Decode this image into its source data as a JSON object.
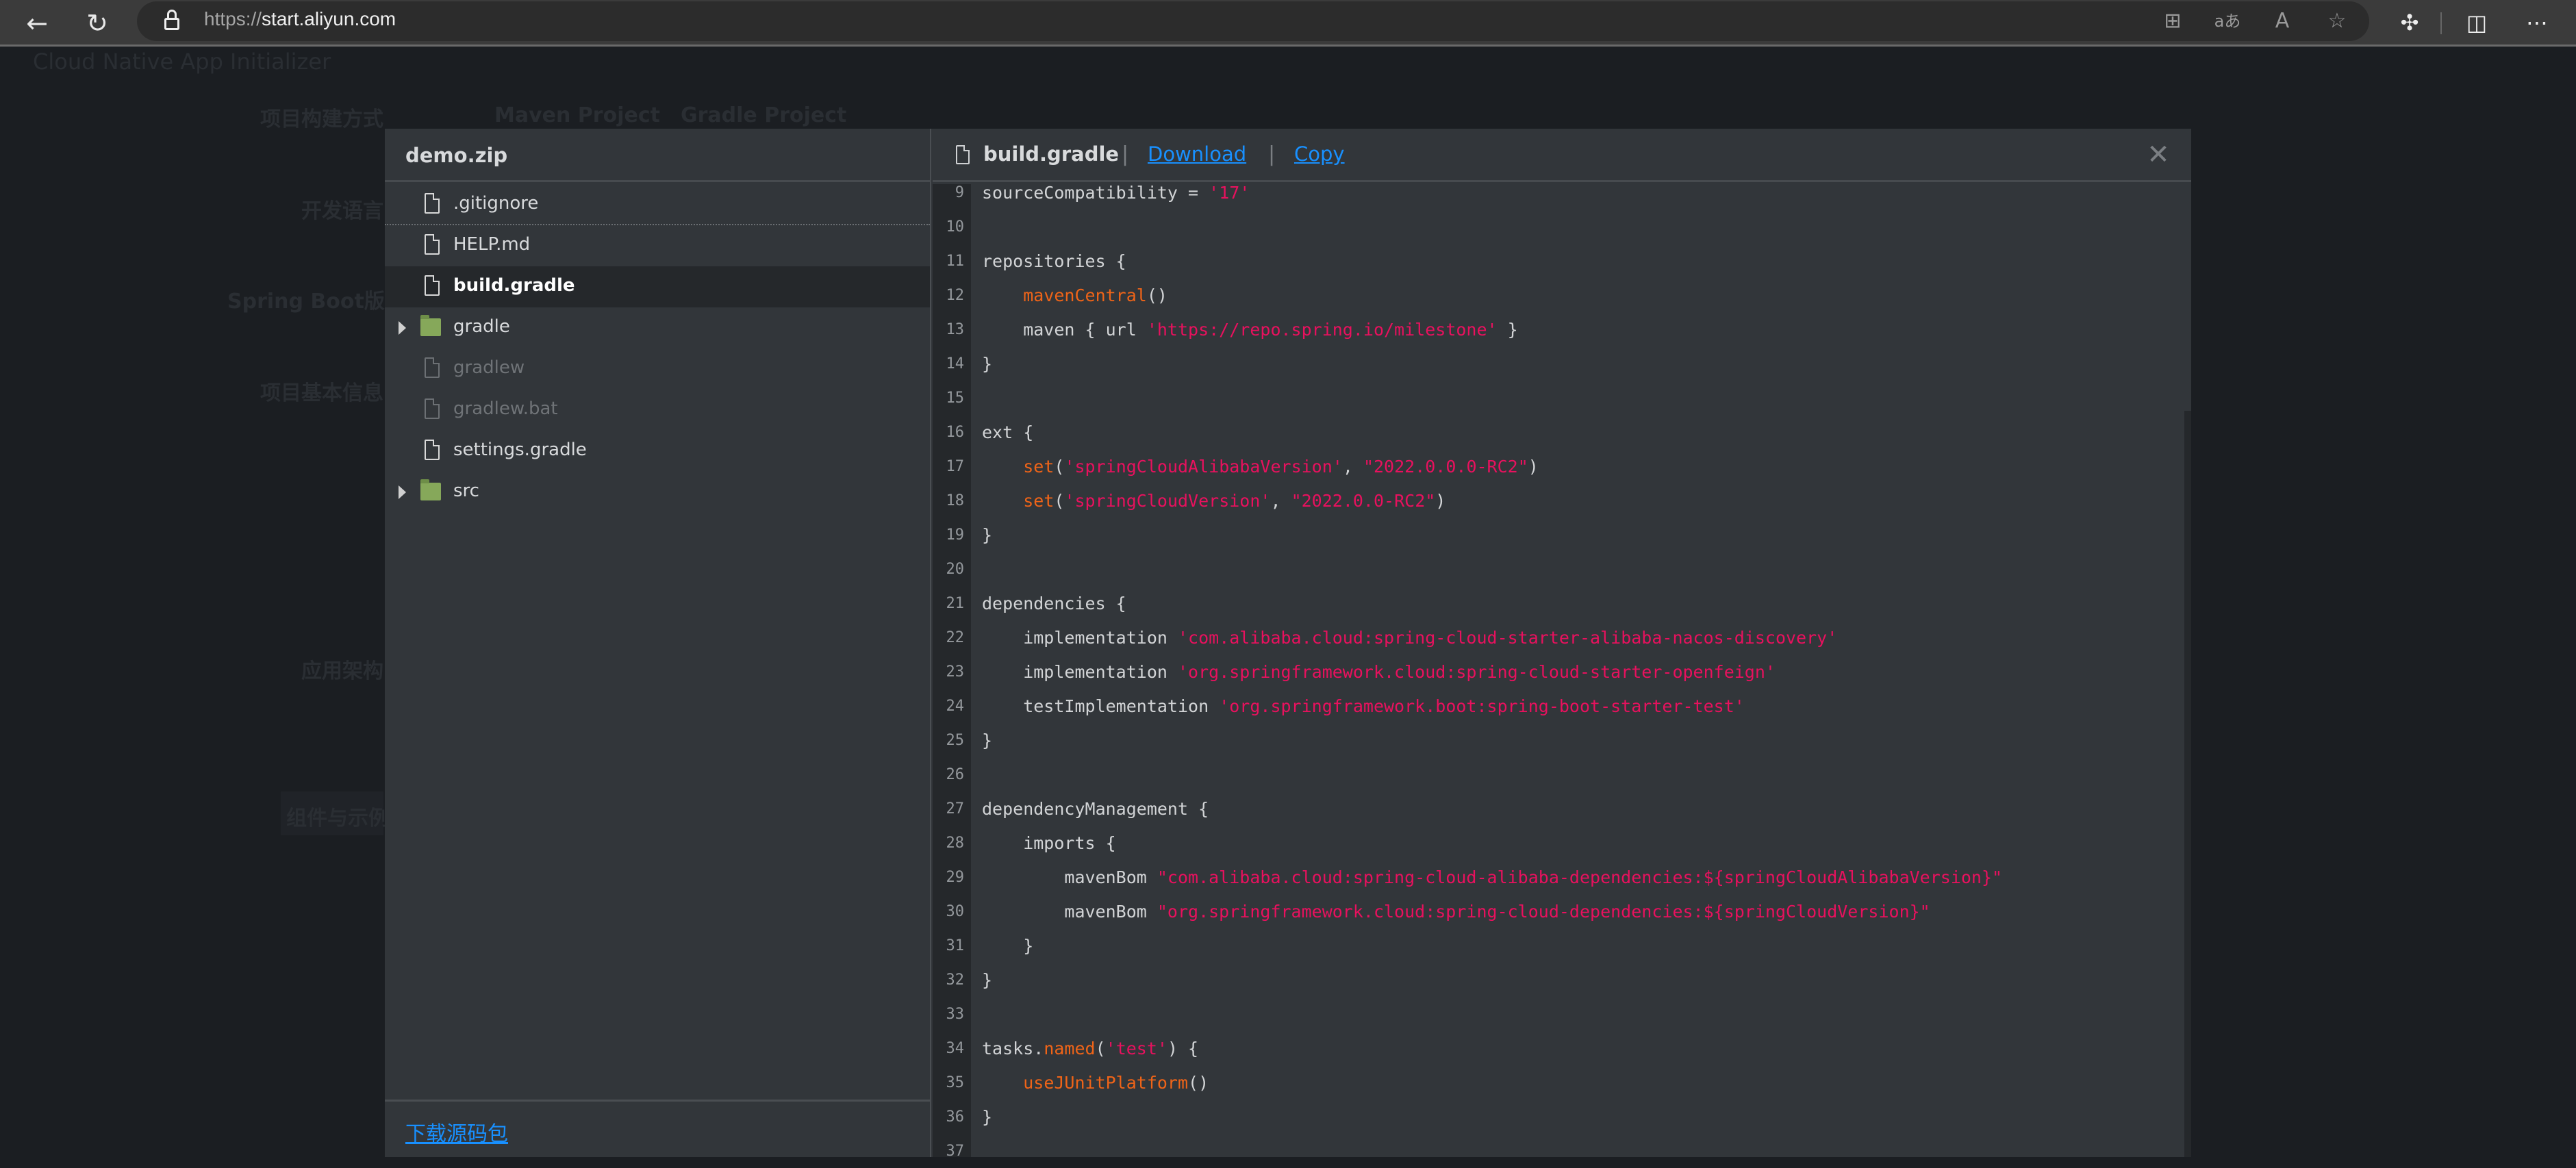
{
  "browser": {
    "url_scheme": "https://",
    "url_host": "start.aliyun.com",
    "icons": [
      "back-arrow-icon",
      "refresh-icon",
      "lock-icon",
      "app-add-icon",
      "translate-icon",
      "read-aloud-icon",
      "favorite-star-icon",
      "extensions-icon",
      "split-screen-icon",
      "more-icon"
    ]
  },
  "background_page": {
    "title": "Cloud Native App Initializer",
    "labels": {
      "build_type": "项目构建方式",
      "maven": "Maven Project",
      "gradle": "Gradle Project",
      "language": "开发语言",
      "spring_boot": "Spring Boot版本",
      "basic_info": "项目基本信息",
      "architecture": "应用架构",
      "components": "组件与示例"
    }
  },
  "modal": {
    "zip_name": "demo.zip",
    "tree": [
      {
        "name": ".gitignore",
        "type": "file",
        "state": "normal"
      },
      {
        "name": "HELP.md",
        "type": "file",
        "state": "normal"
      },
      {
        "name": "build.gradle",
        "type": "file",
        "state": "selected"
      },
      {
        "name": "gradle",
        "type": "folder",
        "state": "collapsed"
      },
      {
        "name": "gradlew",
        "type": "file",
        "state": "dim"
      },
      {
        "name": "gradlew.bat",
        "type": "file",
        "state": "dim"
      },
      {
        "name": "settings.gradle",
        "type": "file",
        "state": "normal"
      },
      {
        "name": "src",
        "type": "folder",
        "state": "collapsed"
      }
    ],
    "download_source_label": "下载源码包",
    "code_header": {
      "filename": "build.gradle",
      "separator": "|",
      "download_label": "Download",
      "copy_label": "Copy",
      "close_glyph": "✕"
    },
    "colors": {
      "string": "#e8115e",
      "function": "#ef6418",
      "link": "#1890ff",
      "folder": "#86a85a"
    },
    "code_lines": [
      {
        "n": "9",
        "tokens": [
          [
            "p",
            "sourceCompatibility = "
          ],
          [
            "s",
            "'17'"
          ]
        ]
      },
      {
        "n": "10",
        "tokens": []
      },
      {
        "n": "11",
        "tokens": [
          [
            "p",
            "repositories {"
          ]
        ]
      },
      {
        "n": "12",
        "tokens": [
          [
            "p",
            "    "
          ],
          [
            "f",
            "mavenCentral"
          ],
          [
            "p",
            "()"
          ]
        ]
      },
      {
        "n": "13",
        "tokens": [
          [
            "p",
            "    maven { url "
          ],
          [
            "s",
            "'https://repo.spring.io/milestone'"
          ],
          [
            "p",
            " }"
          ]
        ]
      },
      {
        "n": "14",
        "tokens": [
          [
            "p",
            "}"
          ]
        ]
      },
      {
        "n": "15",
        "tokens": []
      },
      {
        "n": "16",
        "tokens": [
          [
            "p",
            "ext {"
          ]
        ]
      },
      {
        "n": "17",
        "tokens": [
          [
            "p",
            "    "
          ],
          [
            "f",
            "set"
          ],
          [
            "p",
            "("
          ],
          [
            "s",
            "'springCloudAlibabaVersion'"
          ],
          [
            "p",
            ", "
          ],
          [
            "s",
            "\"2022.0.0.0-RC2\""
          ],
          [
            "p",
            ")"
          ]
        ]
      },
      {
        "n": "18",
        "tokens": [
          [
            "p",
            "    "
          ],
          [
            "f",
            "set"
          ],
          [
            "p",
            "("
          ],
          [
            "s",
            "'springCloudVersion'"
          ],
          [
            "p",
            ", "
          ],
          [
            "s",
            "\"2022.0.0-RC2\""
          ],
          [
            "p",
            ")"
          ]
        ]
      },
      {
        "n": "19",
        "tokens": [
          [
            "p",
            "}"
          ]
        ]
      },
      {
        "n": "20",
        "tokens": []
      },
      {
        "n": "21",
        "tokens": [
          [
            "p",
            "dependencies {"
          ]
        ]
      },
      {
        "n": "22",
        "tokens": [
          [
            "p",
            "    implementation "
          ],
          [
            "s",
            "'com.alibaba.cloud:spring-cloud-starter-alibaba-nacos-discovery'"
          ]
        ]
      },
      {
        "n": "23",
        "tokens": [
          [
            "p",
            "    implementation "
          ],
          [
            "s",
            "'org.springframework.cloud:spring-cloud-starter-openfeign'"
          ]
        ]
      },
      {
        "n": "24",
        "tokens": [
          [
            "p",
            "    testImplementation "
          ],
          [
            "s",
            "'org.springframework.boot:spring-boot-starter-test'"
          ]
        ]
      },
      {
        "n": "25",
        "tokens": [
          [
            "p",
            "}"
          ]
        ]
      },
      {
        "n": "26",
        "tokens": []
      },
      {
        "n": "27",
        "tokens": [
          [
            "p",
            "dependencyManagement {"
          ]
        ]
      },
      {
        "n": "28",
        "tokens": [
          [
            "p",
            "    imports {"
          ]
        ]
      },
      {
        "n": "29",
        "tokens": [
          [
            "p",
            "        mavenBom "
          ],
          [
            "s",
            "\"com.alibaba.cloud:spring-cloud-alibaba-dependencies:${springCloudAlibabaVersion}\""
          ]
        ]
      },
      {
        "n": "30",
        "tokens": [
          [
            "p",
            "        mavenBom "
          ],
          [
            "s",
            "\"org.springframework.cloud:spring-cloud-dependencies:${springCloudVersion}\""
          ]
        ]
      },
      {
        "n": "31",
        "tokens": [
          [
            "p",
            "    }"
          ]
        ]
      },
      {
        "n": "32",
        "tokens": [
          [
            "p",
            "}"
          ]
        ]
      },
      {
        "n": "33",
        "tokens": []
      },
      {
        "n": "34",
        "tokens": [
          [
            "p",
            "tasks."
          ],
          [
            "f",
            "named"
          ],
          [
            "p",
            "("
          ],
          [
            "s",
            "'test'"
          ],
          [
            "p",
            ") {"
          ]
        ]
      },
      {
        "n": "35",
        "tokens": [
          [
            "p",
            "    "
          ],
          [
            "f",
            "useJUnitPlatform"
          ],
          [
            "p",
            "()"
          ]
        ]
      },
      {
        "n": "36",
        "tokens": [
          [
            "p",
            "}"
          ]
        ]
      },
      {
        "n": "37",
        "tokens": []
      }
    ]
  }
}
